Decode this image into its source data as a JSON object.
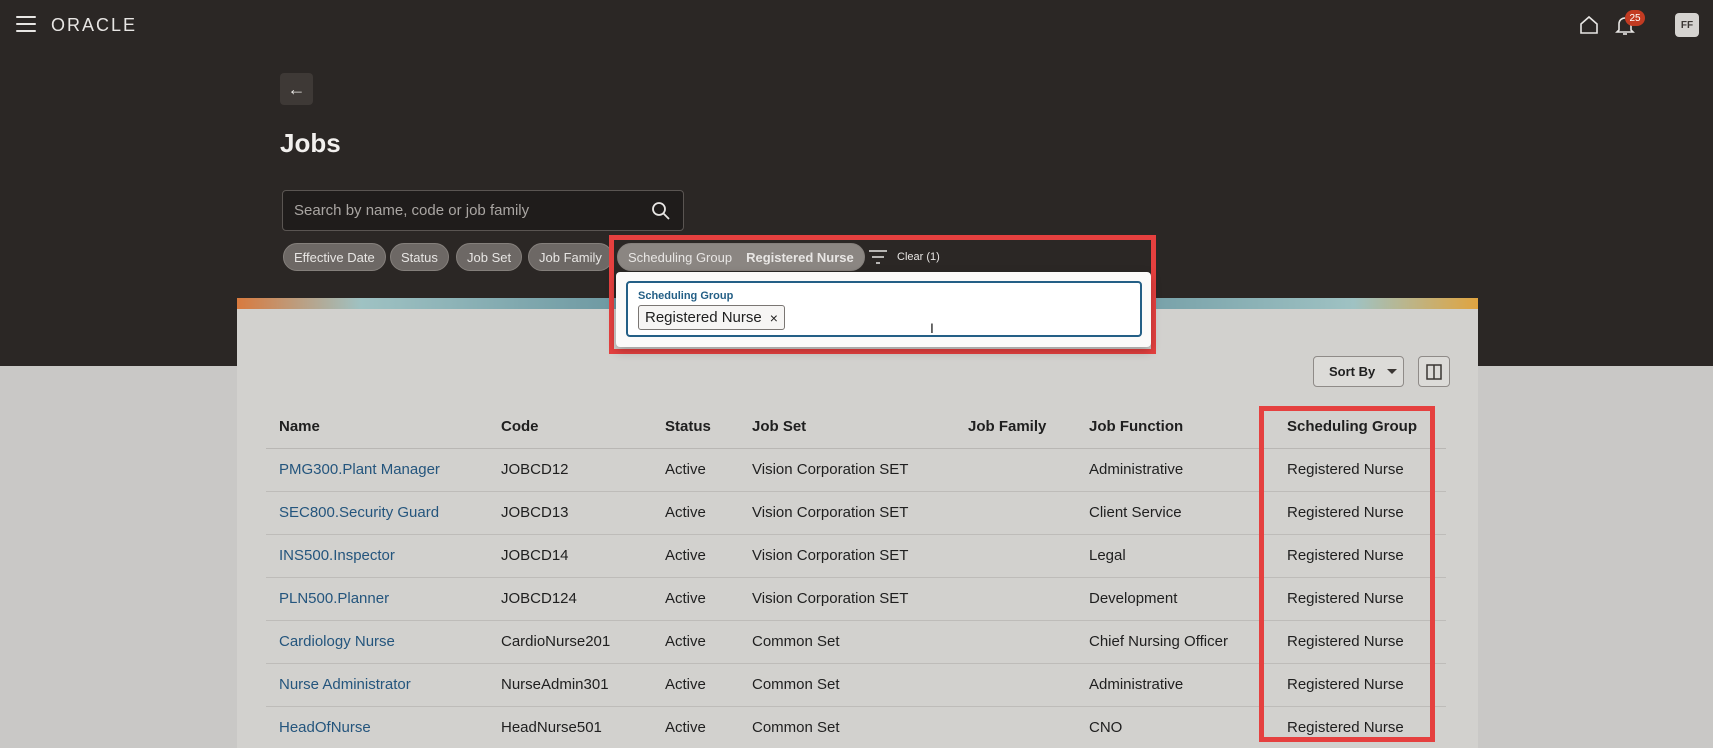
{
  "header": {
    "logo": "ORACLE",
    "notification_count": "25",
    "avatar_initials": "FF"
  },
  "page": {
    "title": "Jobs",
    "back_label": "←"
  },
  "search": {
    "placeholder": "Search by name, code or job family"
  },
  "filters": {
    "chips": [
      "Effective Date",
      "Status",
      "Job Set",
      "Job Family"
    ],
    "active_chip": {
      "label": "Scheduling Group",
      "value": "Registered Nurse"
    },
    "clear_label": "Clear (1)"
  },
  "popup": {
    "field_label": "Scheduling Group",
    "token": "Registered Nurse",
    "token_remove": "×"
  },
  "toolbar": {
    "sort_label": "Sort By"
  },
  "table": {
    "columns": [
      "Name",
      "Code",
      "Status",
      "Job Set",
      "Job Family",
      "Job Function",
      "Scheduling Group"
    ],
    "rows": [
      [
        "PMG300.Plant Manager",
        "JOBCD12",
        "Active",
        "Vision Corporation SET",
        "",
        "Administrative",
        "Registered Nurse"
      ],
      [
        "SEC800.Security Guard",
        "JOBCD13",
        "Active",
        "Vision Corporation SET",
        "",
        "Client Service",
        "Registered Nurse"
      ],
      [
        "INS500.Inspector",
        "JOBCD14",
        "Active",
        "Vision Corporation SET",
        "",
        "Legal",
        "Registered Nurse"
      ],
      [
        "PLN500.Planner",
        "JOBCD124",
        "Active",
        "Vision Corporation SET",
        "",
        "Development",
        "Registered Nurse"
      ],
      [
        "Cardiology Nurse",
        "CardioNurse201",
        "Active",
        "Common Set",
        "",
        "Chief Nursing Officer",
        "Registered Nurse"
      ],
      [
        "Nurse Administrator",
        "NurseAdmin301",
        "Active",
        "Common Set",
        "",
        "Administrative",
        "Registered Nurse"
      ],
      [
        "HeadOfNurse",
        "HeadNurse501",
        "Active",
        "Common Set",
        "",
        "CNO",
        "Registered Nurse"
      ]
    ]
  },
  "colors": {
    "header_bg": "#2b2725",
    "highlight": "#e5403f",
    "link": "#24557d",
    "focus": "#245f86"
  }
}
